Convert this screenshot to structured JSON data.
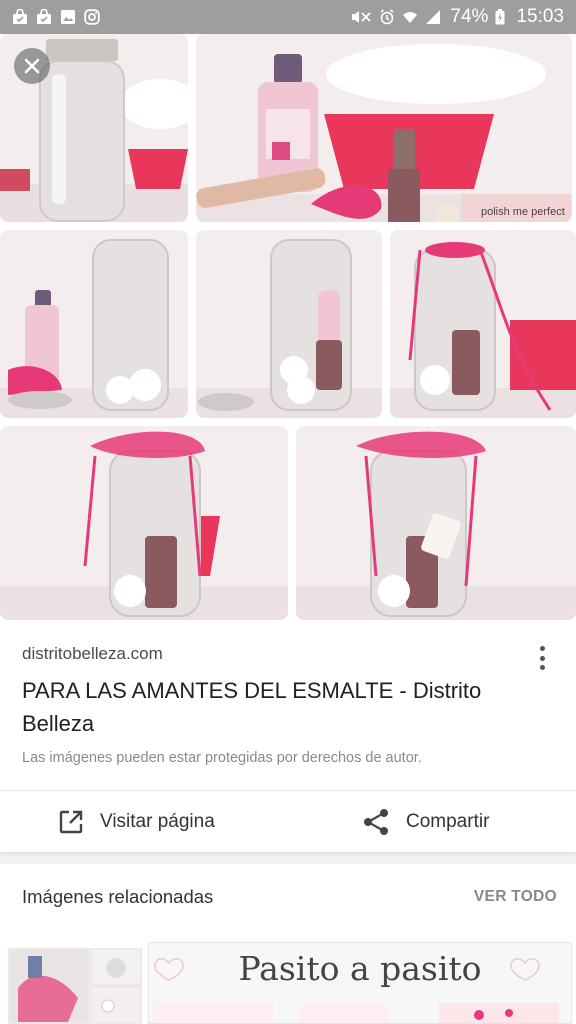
{
  "status_bar": {
    "battery_percent": "74%",
    "time": "15:03",
    "left_icons": [
      "bag-icon",
      "bag-icon",
      "image-icon",
      "instagram-icon"
    ],
    "right_icons": [
      "mute-icon",
      "alarm-icon",
      "wifi-icon",
      "signal-icon",
      "battery-icon"
    ]
  },
  "result": {
    "domain": "distritobelleza.com",
    "title": "PARA LAS AMANTES DEL ESMALTE - Distrito Belleza",
    "copyright_notice": "Las imágenes pueden estar protegidas por derechos de autor."
  },
  "actions": {
    "visit_label": "Visitar página",
    "share_label": "Compartir"
  },
  "related": {
    "heading": "Imágenes relacionadas",
    "see_all": "VER TODO",
    "banner_text": "Pasito a pasito"
  },
  "photo_labels": {
    "polish_bottle": "polish me perfect"
  },
  "colors": {
    "accent_pink": "#e8375a",
    "ribbon_pink": "#e63a78",
    "status_bar": "#9e9e9e"
  }
}
